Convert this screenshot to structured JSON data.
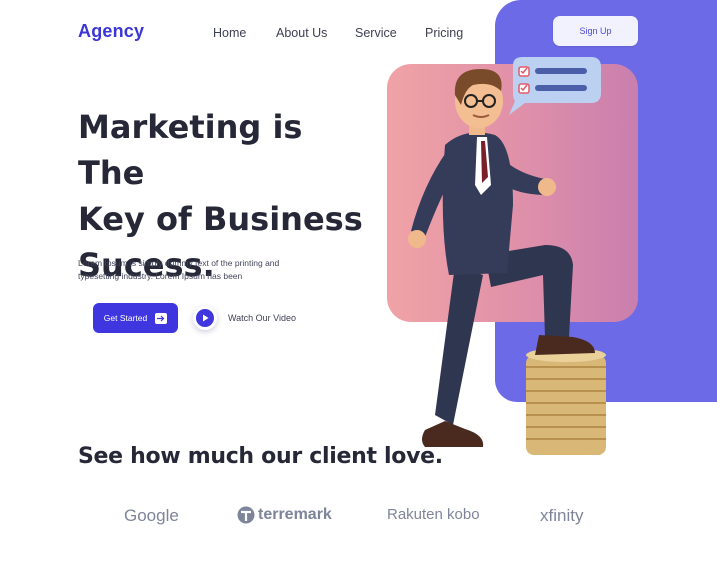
{
  "brand": {
    "logo_text": "Agency"
  },
  "nav": {
    "items": [
      {
        "label": "Home"
      },
      {
        "label": "About Us"
      },
      {
        "label": "Service"
      },
      {
        "label": "Pricing"
      }
    ],
    "signup_label": "Sign Up"
  },
  "hero": {
    "title_lines": [
      "Marketing is The",
      "Key of Business",
      "Sucess."
    ],
    "description_lines": [
      "Lorem Ipsum is simply dummy text of the printing and",
      "typesetting industry. Lorem Ipsum has been"
    ],
    "cta_label": "Get Started",
    "video_label": "Watch Our Video"
  },
  "clients": {
    "title": "See how much our client love.",
    "logos": [
      {
        "name": "Google"
      },
      {
        "name": "terremark"
      },
      {
        "name": "Rakuten kobo"
      },
      {
        "name": "xfinity"
      }
    ]
  },
  "colors": {
    "accent": "#3f36e0",
    "purple_block": "#6c6ae6",
    "pink_card": "#e393a8",
    "logo_gray": "#7e859a"
  },
  "icons": [
    "arrow-right-icon",
    "play-icon",
    "checklist-bubble-icon",
    "coin-stack-icon",
    "terremark-icon"
  ]
}
